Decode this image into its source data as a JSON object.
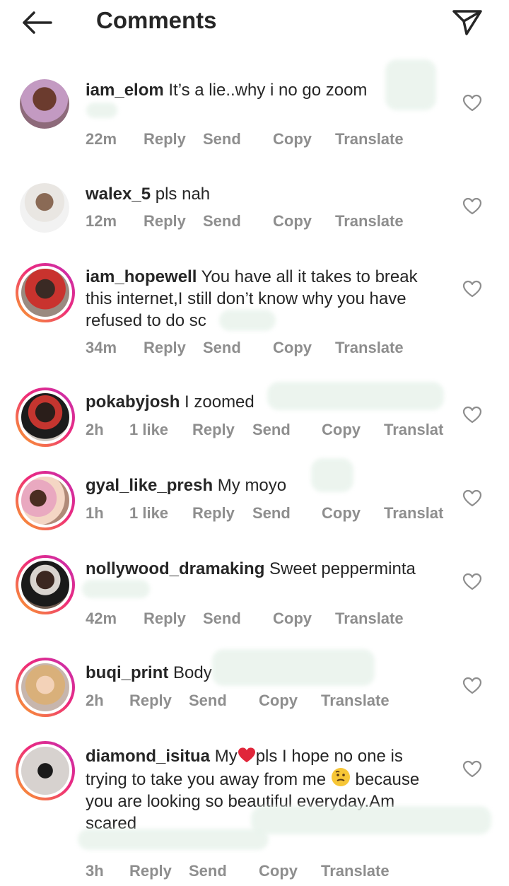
{
  "header": {
    "title": "Comments",
    "back_icon": "arrow-left-icon",
    "share_icon": "paper-plane-icon"
  },
  "colors": {
    "text": "#262626",
    "meta": "#8e8e8e",
    "ring_start": "#f9a629",
    "ring_mid": "#ee2a7b",
    "ring_end": "#c22fb5"
  },
  "comments": [
    {
      "username": "iam_elom",
      "text": "It’s a lie..why i no go zoom",
      "time": "22m",
      "likes": "",
      "reply": "Reply",
      "send": "Send",
      "copy": "Copy",
      "translate": "Translate"
    },
    {
      "username": "walex_5",
      "text": "pls nah",
      "time": "12m",
      "likes": "",
      "reply": "Reply",
      "send": "Send",
      "copy": "Copy",
      "translate": "Translate"
    },
    {
      "username": "iam_hopewell",
      "text": "You have all it takes to break this internet,I still don’t know why you have refused to do sc",
      "time": "34m",
      "likes": "",
      "reply": "Reply",
      "send": "Send",
      "copy": "Copy",
      "translate": "Translate"
    },
    {
      "username": "pokabyjosh",
      "text": "I zoomed",
      "time": "2h",
      "likes": "1 like",
      "reply": "Reply",
      "send": "Send",
      "copy": "Copy",
      "translate": "Translat"
    },
    {
      "username": "gyal_like_presh",
      "text": "My moyo",
      "time": "1h",
      "likes": "1 like",
      "reply": "Reply",
      "send": "Send",
      "copy": "Copy",
      "translate": "Translat"
    },
    {
      "username": "nollywood_dramaking",
      "text": "Sweet pepperminta",
      "time": "42m",
      "likes": "",
      "reply": "Reply",
      "send": "Send",
      "copy": "Copy",
      "translate": "Translate"
    },
    {
      "username": "buqi_print",
      "text": "Body",
      "time": "2h",
      "likes": "",
      "reply": "Reply",
      "send": "Send",
      "copy": "Copy",
      "translate": "Translate"
    },
    {
      "username": "diamond_isitua",
      "text_before": "My",
      "text_after": "pls I hope no one is trying to take you away from me",
      "text_end": "because you are looking so beautiful everyday.Am scared",
      "time": "3h",
      "likes": "",
      "reply": "Reply",
      "send": "Send",
      "copy": "Copy",
      "translate": "Translate"
    }
  ]
}
